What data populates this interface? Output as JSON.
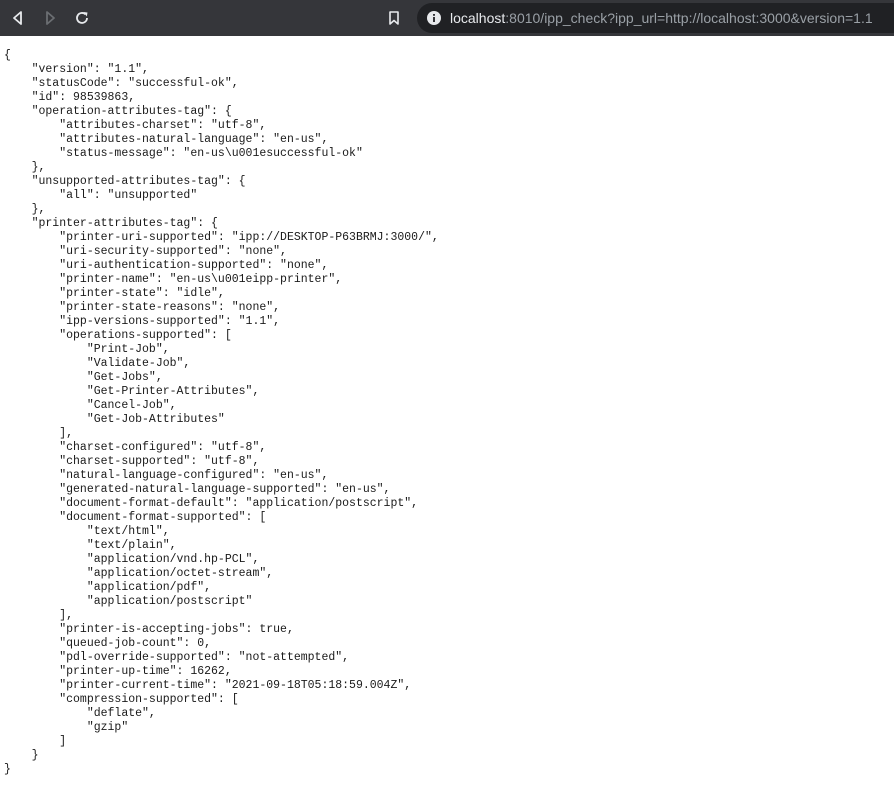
{
  "browser": {
    "address_bar": {
      "host": "localhost",
      "rest": ":8010/ipp_check?ipp_url=http://localhost:3000&version=1.1"
    },
    "icons": {
      "back": "back-arrow-icon",
      "forward": "forward-arrow-icon",
      "reload": "reload-icon",
      "bookmark": "bookmark-icon",
      "site_info": "info-icon"
    },
    "colors": {
      "toolbar": "#35363a",
      "address_bar": "#202124",
      "url_host": "#e8eaed",
      "url_rest": "#9aa0a6"
    }
  },
  "page": {
    "json_lines": [
      "{",
      "    \"version\": \"1.1\",",
      "    \"statusCode\": \"successful-ok\",",
      "    \"id\": 98539863,",
      "    \"operation-attributes-tag\": {",
      "        \"attributes-charset\": \"utf-8\",",
      "        \"attributes-natural-language\": \"en-us\",",
      "        \"status-message\": \"en-us\\u001esuccessful-ok\"",
      "    },",
      "    \"unsupported-attributes-tag\": {",
      "        \"all\": \"unsupported\"",
      "    },",
      "    \"printer-attributes-tag\": {",
      "        \"printer-uri-supported\": \"ipp://DESKTOP-P63BRMJ:3000/\",",
      "        \"uri-security-supported\": \"none\",",
      "        \"uri-authentication-supported\": \"none\",",
      "        \"printer-name\": \"en-us\\u001eipp-printer\",",
      "        \"printer-state\": \"idle\",",
      "        \"printer-state-reasons\": \"none\",",
      "        \"ipp-versions-supported\": \"1.1\",",
      "        \"operations-supported\": [",
      "            \"Print-Job\",",
      "            \"Validate-Job\",",
      "            \"Get-Jobs\",",
      "            \"Get-Printer-Attributes\",",
      "            \"Cancel-Job\",",
      "            \"Get-Job-Attributes\"",
      "        ],",
      "        \"charset-configured\": \"utf-8\",",
      "        \"charset-supported\": \"utf-8\",",
      "        \"natural-language-configured\": \"en-us\",",
      "        \"generated-natural-language-supported\": \"en-us\",",
      "        \"document-format-default\": \"application/postscript\",",
      "        \"document-format-supported\": [",
      "            \"text/html\",",
      "            \"text/plain\",",
      "            \"application/vnd.hp-PCL\",",
      "            \"application/octet-stream\",",
      "            \"application/pdf\",",
      "            \"application/postscript\"",
      "        ],",
      "        \"printer-is-accepting-jobs\": true,",
      "        \"queued-job-count\": 0,",
      "        \"pdl-override-supported\": \"not-attempted\",",
      "        \"printer-up-time\": 16262,",
      "        \"printer-current-time\": \"2021-09-18T05:18:59.004Z\",",
      "        \"compression-supported\": [",
      "            \"deflate\",",
      "            \"gzip\"",
      "        ]",
      "    }",
      "}"
    ]
  }
}
